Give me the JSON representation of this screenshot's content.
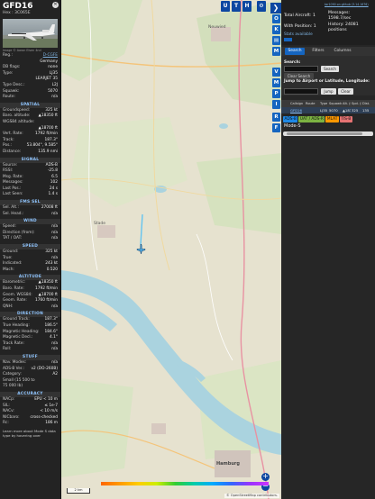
{
  "infopanel": {
    "callsign": "GFD16",
    "reg_line": "Hex : 3C065E",
    "photo_credit": "Image © Aaron Elsen 4nd",
    "basic": [
      {
        "k": "Reg.:",
        "v": "D-CGFE",
        "link": true
      },
      {
        "k": "",
        "v": "Germany"
      },
      {
        "k": "DB flags:",
        "v": "none"
      },
      {
        "k": "Type:",
        "v": "LJ35"
      },
      {
        "k": "",
        "v": "LEARJET 35"
      },
      {
        "k": "Type Desc.:",
        "v": "L2J"
      },
      {
        "k": "Squawk:",
        "v": "5070"
      },
      {
        "k": "Route:",
        "v": "n/a"
      }
    ],
    "sections": [
      {
        "title": "SPATIAL",
        "rows": [
          {
            "k": "Groundspeed:",
            "v": "325 kt"
          },
          {
            "k": "Baro. altitude:",
            "v": "▲18350 ft"
          },
          {
            "k": "WGS84 altitude:",
            "v": ""
          },
          {
            "k": "",
            "v": "▲18700 ft"
          },
          {
            "k": "Vert. Rate:",
            "v": "1792 ft/min"
          },
          {
            "k": "Track:",
            "v": "187.3°"
          },
          {
            "k": "Pos.:",
            "v": "53.804°, 9.585°"
          },
          {
            "k": "Distance:",
            "v": "135.9 nmi"
          }
        ]
      },
      {
        "title": "SIGNAL",
        "rows": [
          {
            "k": "Source:",
            "v": "ADS-B"
          },
          {
            "k": "RSSI:",
            "v": "-25.8"
          },
          {
            "k": "Msg. Rate:",
            "v": "6.5"
          },
          {
            "k": "Messages:",
            "v": "102"
          },
          {
            "k": "Last Pos.:",
            "v": "24 s"
          },
          {
            "k": "Last Seen:",
            "v": "1.4 s"
          }
        ]
      },
      {
        "title": "FMS SEL",
        "rows": [
          {
            "k": "Sel. Alt.:",
            "v": "27008 ft"
          },
          {
            "k": "Sel. Head.:",
            "v": "n/a"
          }
        ]
      },
      {
        "title": "WIND",
        "rows": [
          {
            "k": "Speed:",
            "v": "n/a"
          },
          {
            "k": "Direction (from):",
            "v": "n/a"
          },
          {
            "k": "TAT / OAT:",
            "v": "n/a"
          }
        ]
      },
      {
        "title": "SPEED",
        "rows": [
          {
            "k": "Ground:",
            "v": "325 kt"
          },
          {
            "k": "True:",
            "v": "n/a"
          },
          {
            "k": "Indicated:",
            "v": "243 kt"
          },
          {
            "k": "Mach:",
            "v": "0.520"
          }
        ]
      },
      {
        "title": "ALTITUDE",
        "rows": [
          {
            "k": "Barometric:",
            "v": "▲18350 ft"
          },
          {
            "k": "Baro. Rate:",
            "v": "1792 ft/min"
          },
          {
            "k": "Geom. WGS84:",
            "v": "▲18700 ft"
          },
          {
            "k": "Geom. Rate:",
            "v": "1760 ft/min"
          },
          {
            "k": "QNH:",
            "v": "n/a"
          }
        ]
      },
      {
        "title": "DIRECTION",
        "rows": [
          {
            "k": "Ground Track:",
            "v": "187.3°"
          },
          {
            "k": "True Heading:",
            "v": "186.5°"
          },
          {
            "k": "Magnetic Heading:",
            "v": "184.6°"
          },
          {
            "k": "Magnetic Decl.:",
            "v": "4.1°"
          },
          {
            "k": "Track Rate:",
            "v": "n/a"
          },
          {
            "k": "Roll:",
            "v": "n/a"
          }
        ]
      },
      {
        "title": "STUFF",
        "rows": [
          {
            "k": "Nav. Modes:",
            "v": "n/a"
          },
          {
            "k": "ADS-B Ver.:",
            "v": "v2 (DO-260B)"
          },
          {
            "k": "Category:",
            "v": "A2"
          },
          {
            "k": "Small (15 500 to",
            "v": ""
          },
          {
            "k": "75 000 lb)",
            "v": ""
          }
        ]
      },
      {
        "title": "ACCURACY",
        "rows": [
          {
            "k": "NACp:",
            "v": "EPU < 10 m"
          },
          {
            "k": "SIL:",
            "v": "≤ 1e-7"
          },
          {
            "k": "NACv:",
            "v": "< 10 m/s"
          },
          {
            "k": "NICbaro:",
            "v": "cross-checked"
          },
          {
            "k": "Rc:",
            "v": "186 m"
          }
        ]
      }
    ],
    "footer": "Learn more about Mode S data type by hovering over"
  },
  "map": {
    "top_buttons": [
      "U",
      "T",
      "H"
    ],
    "side_buttons": [
      "O",
      "K",
      "M",
      "V",
      "M",
      "P",
      "I",
      "R",
      "F"
    ],
    "zoom_in": "+",
    "zoom_out": "−",
    "scale_label": "2 km",
    "attribution": "© OpenStreetMap contributors.",
    "place_labels": [
      {
        "text": "Neuwied",
        "id": "lbl1"
      },
      {
        "text": "Stade",
        "id": "lbl2"
      },
      {
        "text": "Hamburg",
        "id": "lbl3"
      }
    ],
    "aircraft_color": "#4fb0e8",
    "track_color": "#63c4f0"
  },
  "rightpanel": {
    "toggle_arrow": "❯",
    "top_links": "tar1090 on github (3.14.1676)",
    "total_aircraft": "Total Aircraft: 1",
    "with_position": "With Position: 1",
    "messages_label": "Messages:",
    "messages_value": "1598.7/sec",
    "history_label": "History: 24081",
    "history_value": "positions",
    "stats_link": "Stats available",
    "tabs": [
      "Search",
      "Filters",
      "Columns"
    ],
    "search_label": "Search:",
    "search_button": "Search",
    "clear_search": "Clear Search",
    "jump_label": "Jump to Airport or Latitude, Longitude:",
    "jump_button": "Jump",
    "clear_button": "Clear",
    "table_headers": [
      "",
      "Callsign",
      "Route",
      "Type",
      "Squawk",
      "Alt. (ft)",
      "Spd. (kt)",
      "Dist."
    ],
    "table_rows": [
      [
        "",
        "GFD16",
        "",
        "LJ35",
        "5070",
        "▲18350",
        "325",
        "135"
      ]
    ],
    "sources": [
      {
        "label": "ADS-B",
        "color": "#1e88e5"
      },
      {
        "label": "UAT / ADS-R",
        "color": "#7cb342"
      },
      {
        "label": "MLAT",
        "color": "#ff9800"
      },
      {
        "label": "TIS-B",
        "color": "#e57373"
      }
    ],
    "modes_label": "Mode-S"
  }
}
